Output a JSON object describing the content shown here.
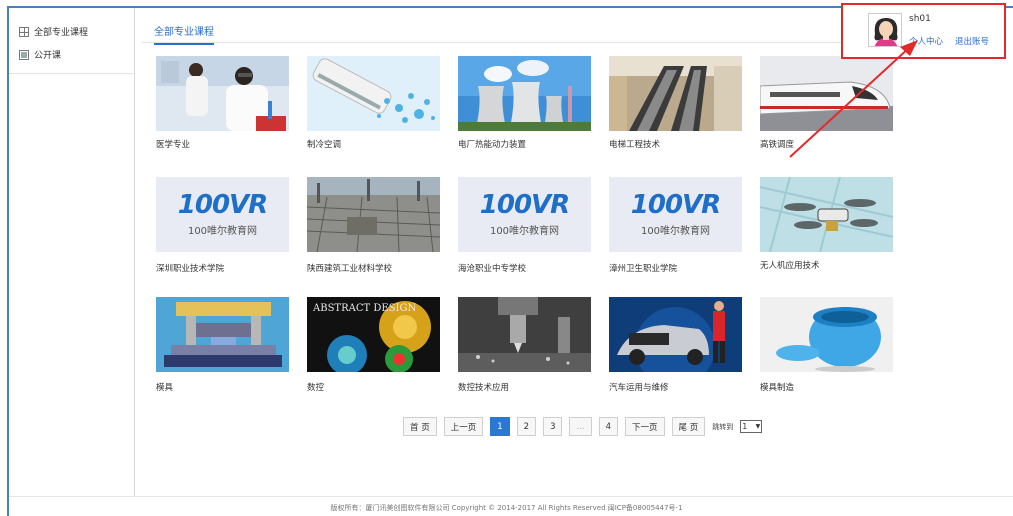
{
  "sidebar": {
    "items": [
      {
        "label": "全部专业课程",
        "icon": "grid-icon"
      },
      {
        "label": "公开课",
        "icon": "book-icon"
      }
    ]
  },
  "tab": {
    "label": "全部专业课程"
  },
  "courses": [
    {
      "title": "医学专业"
    },
    {
      "title": "制冷空调"
    },
    {
      "title": "电厂热能动力装置"
    },
    {
      "title": "电梯工程技术"
    },
    {
      "title": "高铁调度"
    },
    {
      "title": "深圳职业技术学院",
      "logo": "100VR",
      "logo_sub": "100唯尔教育网"
    },
    {
      "title": "陕西建筑工业材料学校"
    },
    {
      "title": "海沧职业中专学校",
      "logo": "100VR",
      "logo_sub": "100唯尔教育网"
    },
    {
      "title": "漳州卫生职业学院",
      "logo": "100VR",
      "logo_sub": "100唯尔教育网"
    },
    {
      "title": "无人机应用技术"
    },
    {
      "title": "模具"
    },
    {
      "title": "数控",
      "banner": "ABSTRACT DESIGN"
    },
    {
      "title": "数控技术应用"
    },
    {
      "title": "汽车运用与维修"
    },
    {
      "title": "模具制造"
    }
  ],
  "pager": {
    "first": "首 页",
    "prev": "上一页",
    "pages": [
      "1",
      "2",
      "3",
      "...",
      "4"
    ],
    "current": "1",
    "next": "下一页",
    "last": "尾 页",
    "jump_label": "跳转到",
    "jump_value": "1"
  },
  "user": {
    "name": "sh01",
    "center_link": "个人中心",
    "logout_link": "退出账号"
  },
  "footer": {
    "text": "版权所有：厦门讯美创图软件有限公司   Copyright © 2014-2017   All Rights Reserved  闽ICP备08005447号-1"
  },
  "colors": {
    "accent": "#2a6fc9",
    "highlight": "#e12b2b",
    "frame": "#4a7fc1"
  }
}
